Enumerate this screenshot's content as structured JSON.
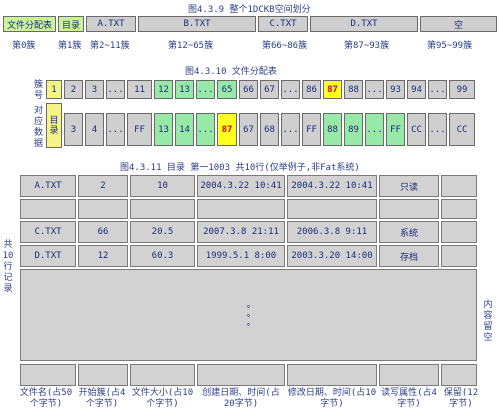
{
  "fig1": {
    "caption": "图4.3.9 整个1DCKB空间划分",
    "areas": [
      "文件分配表",
      "目录",
      "A.TXT",
      "B.TXT",
      "C.TXT",
      "D.TXT",
      "空"
    ],
    "ranges": [
      "第0簇",
      "第1簇",
      "第2~11簇",
      "第12~65簇",
      "第66~86簇",
      "第87~93簇",
      "第95~99簇"
    ]
  },
  "fig2": {
    "caption": "图4.3.10 文件分配表",
    "row1_label": "簇号",
    "row2_label": "对应数据",
    "row1": [
      "1",
      "2",
      "3",
      "...",
      "11",
      "12",
      "13",
      "...",
      "65",
      "66",
      "67",
      "...",
      "86",
      "87",
      "88",
      "...",
      "93",
      "94",
      "...",
      "99"
    ],
    "row2": [
      "目录",
      "3",
      "4",
      "...",
      "FF",
      "13",
      "14",
      "...",
      "87",
      "67",
      "68",
      "...",
      "FF",
      "88",
      "89",
      "...",
      "FF",
      "CC",
      "...",
      "CC"
    ]
  },
  "fig3": {
    "caption": "图4.3.11 目录 第一1003 共10行(仅举例子,非Fat系统)",
    "rows": [
      [
        "A.TXT",
        "2",
        "10",
        "2004.3.22 10:41",
        "2004.3.22 10:41",
        "只读"
      ],
      [
        "",
        "",
        "",
        "",
        "",
        ""
      ],
      [
        "C.TXT",
        "66",
        "20.5",
        "2007.3.8 21:11",
        "2006.3.8 9:11",
        "系统"
      ],
      [
        "D.TXT",
        "12",
        "60.3",
        "1999.5.1 8:00",
        "2003.3.20 14:00",
        "存档"
      ]
    ],
    "left_label": "共10行记录",
    "right_label": "内容留空",
    "footer": [
      "文件名(占50个字节)",
      "开始簇(占4个字节)",
      "文件大小(占10个字节)",
      "创建日期、时间(占20字节)",
      "修改日期、时间(占10字节)",
      "读写属性(占4字节)",
      "保留(12字节)"
    ]
  }
}
